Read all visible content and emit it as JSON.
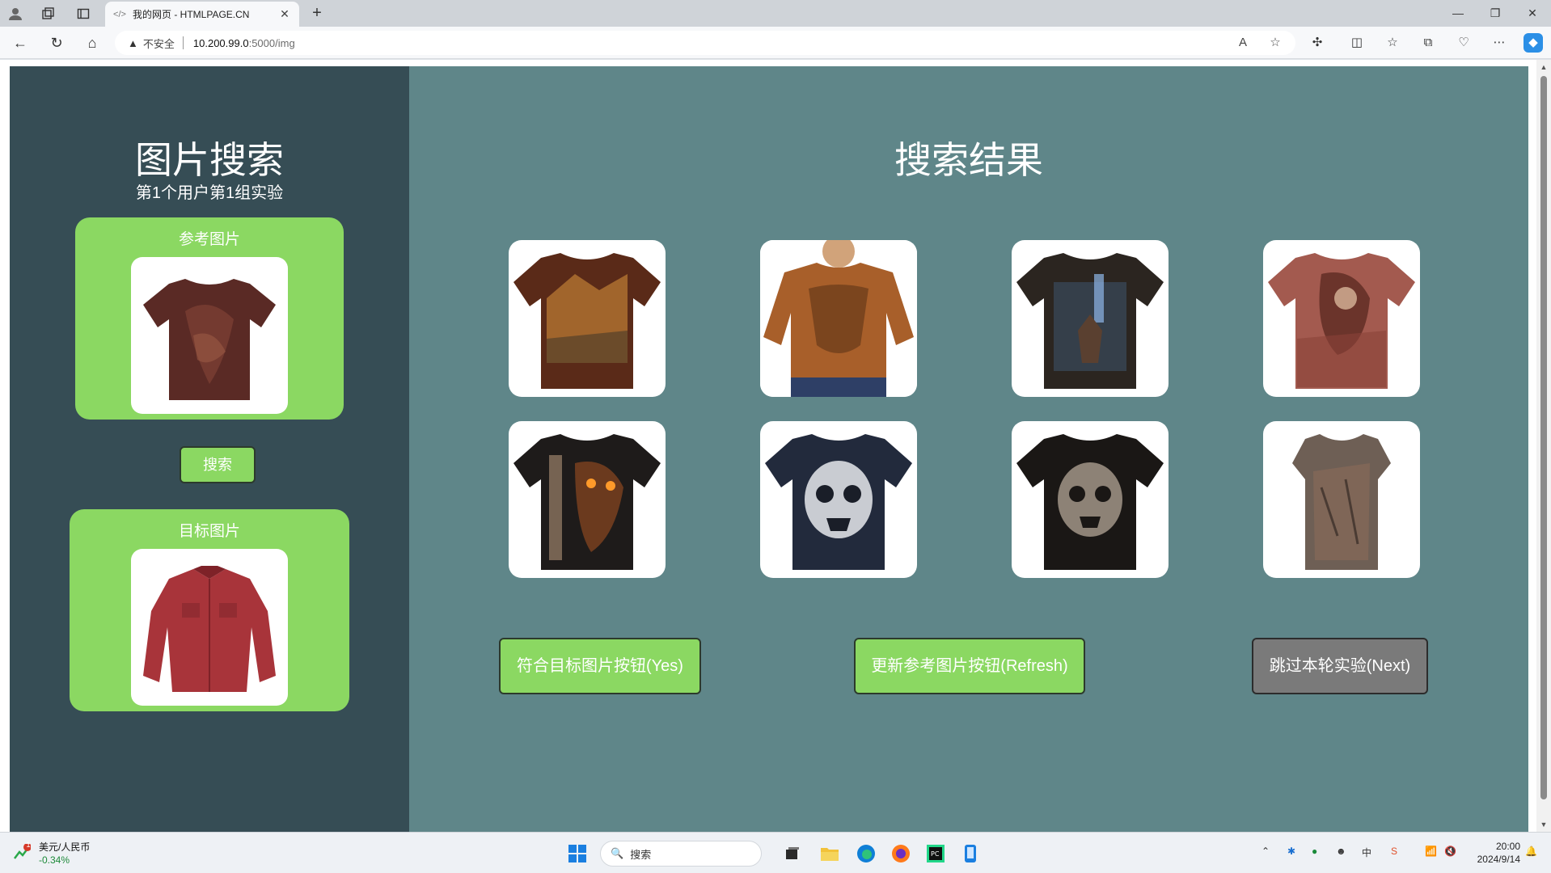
{
  "browser": {
    "tab_title": "我的网页 - HTMLPAGE.CN",
    "security_label": "不安全",
    "url_host": "10.200.99.0",
    "url_path": ":5000/img"
  },
  "left_panel": {
    "title": "图片搜索",
    "subtitle": "第1个用户第1组实验",
    "reference_label": "参考图片",
    "search_button": "搜索",
    "target_label": "目标图片"
  },
  "right_panel": {
    "title": "搜索结果",
    "results": [
      {
        "desc": "brown mountain landscape tee"
      },
      {
        "desc": "man in brown affliction tee"
      },
      {
        "desc": "dark forest deer tee"
      },
      {
        "desc": "red grunge portrait tee"
      },
      {
        "desc": "black disturbed tee"
      },
      {
        "desc": "navy skull tee"
      },
      {
        "desc": "black skull tee"
      },
      {
        "desc": "grey brown faded tee"
      }
    ],
    "yes_button": "符合目标图片按钮(Yes)",
    "refresh_button": "更新参考图片按钮(Refresh)",
    "next_button": "跳过本轮实验(Next)"
  },
  "taskbar": {
    "stock_name": "美元/人民币",
    "stock_change": "-0.34%",
    "stock_badge": "1",
    "search_placeholder": "搜索",
    "time": "20:00",
    "date": "2024/9/14"
  },
  "colors": {
    "left_bg": "#364d55",
    "right_bg": "#5f8689",
    "accent_green": "#8bd862",
    "next_gray": "#7a7a7a"
  }
}
